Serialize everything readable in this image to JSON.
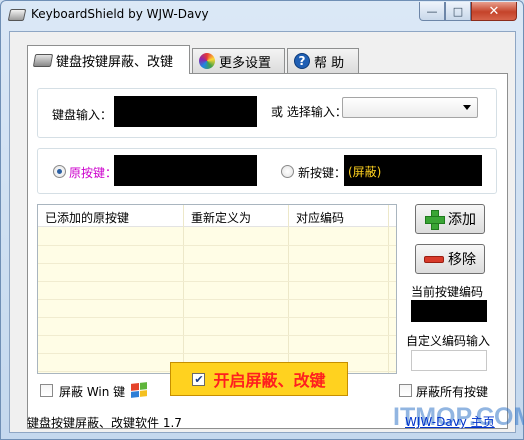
{
  "window": {
    "title": "KeyboardShield by WJW-Davy",
    "controls": {
      "minimize": "—",
      "maximize": "□",
      "close": "✕"
    }
  },
  "tabs": [
    {
      "label": "键盘按键屏蔽、改键",
      "icon": "keyboard-icon",
      "active": true
    },
    {
      "label": "更多设置",
      "icon": "color-wheel-icon",
      "active": false
    },
    {
      "label": "帮 助",
      "icon": "help-icon",
      "active": false
    }
  ],
  "keyboard_input": {
    "label": "键盘输入：",
    "value": ""
  },
  "select_input": {
    "label": "或 选择输入：",
    "value": ""
  },
  "original_key": {
    "label": "原按键：",
    "selected": true,
    "value": ""
  },
  "new_key": {
    "label": "新按键：",
    "selected": false,
    "value": "(屏蔽)"
  },
  "table": {
    "columns": [
      "已添加的原按键",
      "重新定义为",
      "对应编码"
    ],
    "rows": []
  },
  "buttons": {
    "add": "添加",
    "remove": "移除",
    "toggle": "开启屏蔽、改键"
  },
  "current_code": {
    "label": "当前按键编码",
    "value": ""
  },
  "custom_code": {
    "label": "自定义编码输入",
    "value": ""
  },
  "options": {
    "block_win": {
      "label": "屏蔽 Win 键",
      "checked": false
    },
    "block_all": {
      "label": "屏蔽所有按键",
      "checked": false
    }
  },
  "status": {
    "text": "键盘按键屏蔽、改键软件 1.7",
    "homepage": "WJW-Davy 主页",
    "watermark": "ITMOP.COM"
  },
  "colors": {
    "original_key_label": "#cc00cc",
    "new_key_value": "#ffd21f",
    "toggle_bg": "#ffd21f",
    "toggle_text": "#ff1f1f",
    "table_bg": "#fffde6"
  }
}
